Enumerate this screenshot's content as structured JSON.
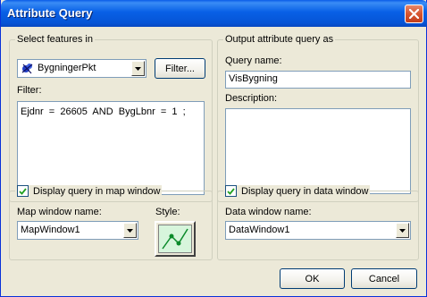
{
  "window": {
    "title": "Attribute Query"
  },
  "select_group": {
    "legend": "Select features in",
    "layer_value": "BygningerPkt",
    "filter_button": "Filter...",
    "filter_label": "Filter:",
    "filter_text": "Ejdnr  =  26605  AND  BygLbnr  =  1  ;"
  },
  "output_group": {
    "legend": "Output attribute query as",
    "query_name_label": "Query name:",
    "query_name_value": "VisBygning",
    "description_label": "Description:",
    "description_value": ""
  },
  "map_group": {
    "legend": "Display query in map window",
    "checked": true,
    "map_window_label": "Map window name:",
    "map_window_value": "MapWindow1",
    "style_label": "Style:"
  },
  "data_group": {
    "legend": "Display query in data window",
    "checked": true,
    "data_window_label": "Data window name:",
    "data_window_value": "DataWindow1"
  },
  "footer": {
    "ok": "OK",
    "cancel": "Cancel"
  }
}
